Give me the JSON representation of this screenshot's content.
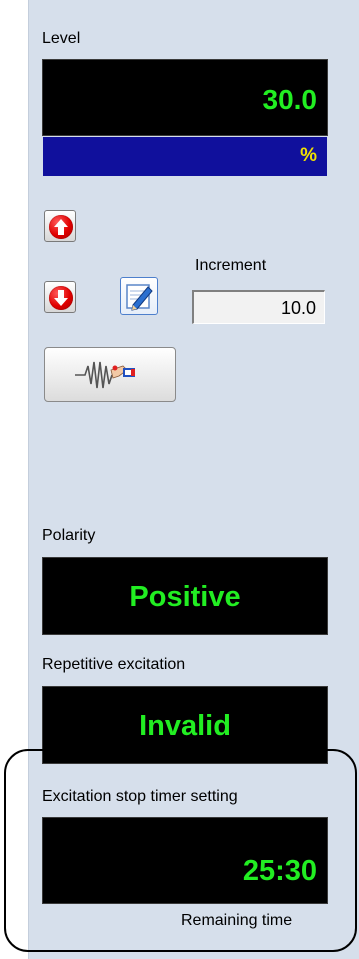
{
  "level": {
    "label": "Level",
    "value": "30.0",
    "unit": "%"
  },
  "controls": {
    "up_icon": "red-up-arrow-icon",
    "down_icon": "red-down-arrow-icon",
    "edit_icon": "pencil-edit-icon",
    "wave_icon": "waveform-hand-icon"
  },
  "increment": {
    "label": "Increment",
    "value": "10.0"
  },
  "polarity": {
    "label": "Polarity",
    "value": "Positive"
  },
  "repetitive": {
    "label": "Repetitive excitation",
    "value": "Invalid"
  },
  "timer": {
    "label": "Excitation stop timer setting",
    "value": "25:30",
    "sub_label": "Remaining time"
  },
  "colors": {
    "panel_background": "#d6dfeb",
    "display_background": "#000000",
    "display_text": "#22ee22",
    "unit_bar": "#10109c",
    "unit_text": "#f0e000",
    "button_red": "#e00000"
  }
}
